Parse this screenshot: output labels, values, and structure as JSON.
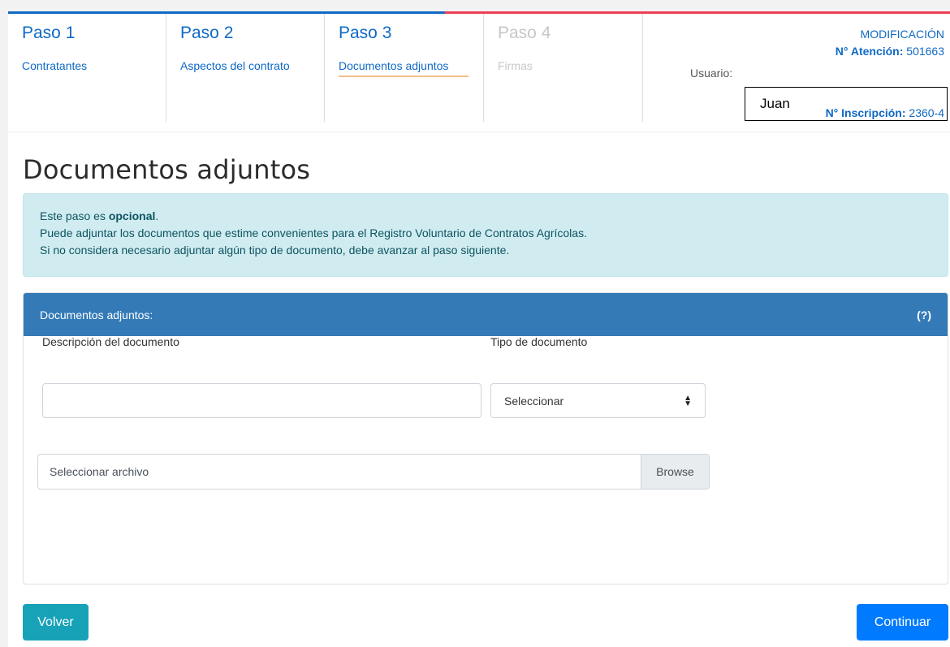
{
  "steps": [
    {
      "number": "Paso 1",
      "label": "Contratantes"
    },
    {
      "number": "Paso 2",
      "label": "Aspectos del contrato"
    },
    {
      "number": "Paso 3",
      "label": "Documentos adjuntos"
    },
    {
      "number": "Paso 4",
      "label": "Firmas"
    }
  ],
  "meta": {
    "mode": "MODIFICACIÓN",
    "atencion_label": "N° Atención:",
    "atencion_value": "501663",
    "usuario_label": "Usuario:",
    "usuario_value": "Juan",
    "inscripcion_label": "N° Inscripción:",
    "inscripcion_value": "2360-4"
  },
  "page": {
    "title": "Documentos adjuntos"
  },
  "alert": {
    "line1_prefix": "Este paso es ",
    "line1_bold": "opcional",
    "line1_suffix": ".",
    "line2": "Puede adjuntar los documentos que estime convenientes para el Registro Voluntario de Contratos Agrícolas.",
    "line3": "Si no considera necesario adjuntar algún tipo de documento, debe avanzar al paso siguiente."
  },
  "panel": {
    "title": "Documentos adjuntos:",
    "help": "(?)",
    "description_label": "Descripción del documento",
    "description_value": "",
    "type_label": "Tipo de documento",
    "type_selected": "Seleccionar",
    "file_placeholder": "Seleccionar archivo",
    "browse_label": "Browse"
  },
  "buttons": {
    "back": "Volver",
    "continue": "Continuar"
  },
  "colors": {
    "primary_blue": "#0f69c4",
    "accent_red": "#ed3f55",
    "panel_header": "#337ab7",
    "info_bg": "#d1ecf1",
    "back_button": "#17a2b8",
    "continue_button": "#007bff"
  }
}
